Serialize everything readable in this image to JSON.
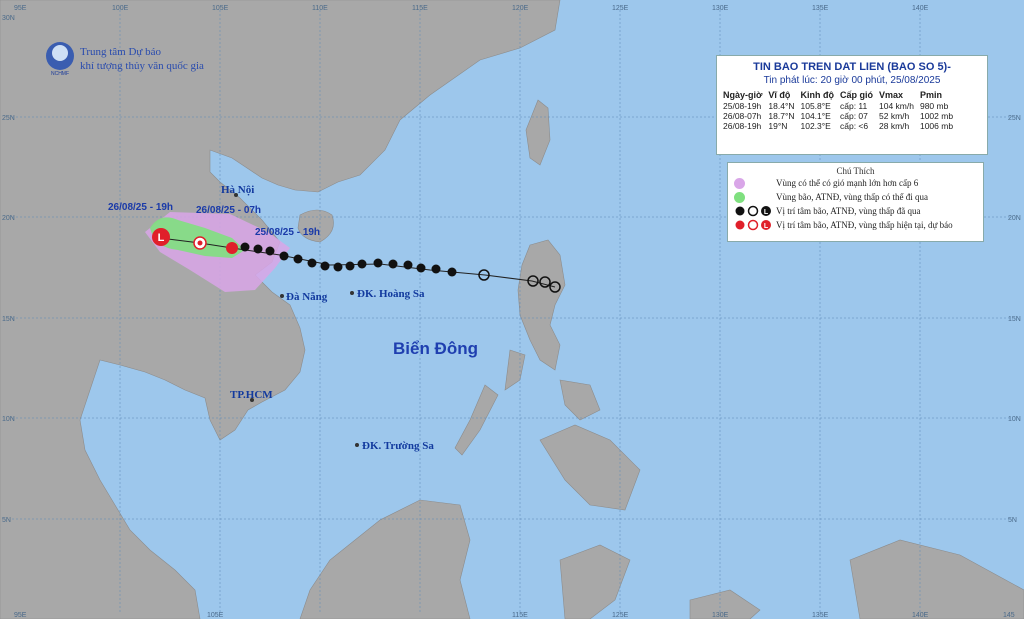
{
  "logo": {
    "line1": "Trung tâm Dự báo",
    "line2": "khí tượng thủy văn quốc gia",
    "badge": "NCHMF"
  },
  "panel": {
    "title": "TIN BAO TREN DAT LIEN (BAO SO 5)-",
    "subtitle": "Tin phát lúc: 20 giờ 00 phút, 25/08/2025",
    "headers": [
      "Ngày-giờ",
      "Vĩ độ",
      "Kinh độ",
      "Cấp gió",
      "Vmax",
      "Pmin"
    ],
    "rows": [
      [
        "25/08-19h",
        "18.4°N",
        "105.8°E",
        "cấp: 11",
        "104 km/h",
        "980 mb"
      ],
      [
        "26/08-07h",
        "18.7°N",
        "104.1°E",
        "cấp: 07",
        "52 km/h",
        "1002 mb"
      ],
      [
        "26/08-19h",
        "19°N",
        "102.3°E",
        "cấp: <6",
        "28 km/h",
        "1006 mb"
      ]
    ]
  },
  "legend": {
    "title": "Chú Thích",
    "items": [
      {
        "text": "Vùng có thể có gió mạnh lớn hơn cấp 6",
        "color": "#d9a6e8"
      },
      {
        "text": "Vùng bão, ATNĐ, vùng thấp có thể đi qua",
        "color": "#7fe07f"
      },
      {
        "text": "Vị trí tâm bão, ATNĐ, vùng thấp đã qua",
        "color": "#111111"
      },
      {
        "text": "Vị trí tâm bão, ATNĐ, vùng thấp hiện tại, dự báo",
        "color": "#e0202a"
      }
    ]
  },
  "places": {
    "hanoi": "Hà Nội",
    "danang": "Đà Nẵng",
    "hoangsa": "ĐK. Hoàng Sa",
    "hcm": "TP.HCM",
    "truongsa": "ĐK. Trường Sa",
    "sea": "Biển Đông"
  },
  "forecast_labels": {
    "t0": "25/08/25 - 19h",
    "t1": "26/08/25 - 07h",
    "t2": "26/08/25 - 19h"
  },
  "axes": {
    "top": [
      "95E",
      "100E",
      "105E",
      "110E",
      "115E",
      "120E",
      "125E",
      "130E",
      "135E",
      "140E"
    ],
    "bottom": [
      "95E",
      "105E",
      "115E",
      "125E",
      "130E",
      "135E",
      "140E",
      "145"
    ],
    "left": [
      "25N",
      "20N",
      "15N",
      "10N",
      "5N",
      "30N"
    ],
    "right": [
      "25N",
      "20N",
      "15N",
      "10N",
      "5N"
    ]
  },
  "storm_center_markers": [
    "L",
    "●",
    "L"
  ],
  "colors": {
    "sea": "#9dc7ec",
    "land": "#aaaaaa",
    "wind_zone": "#d9a6e8",
    "storm_zone": "#7fe07f",
    "current": "#e0202a",
    "text_blue": "#1a3aa8"
  }
}
